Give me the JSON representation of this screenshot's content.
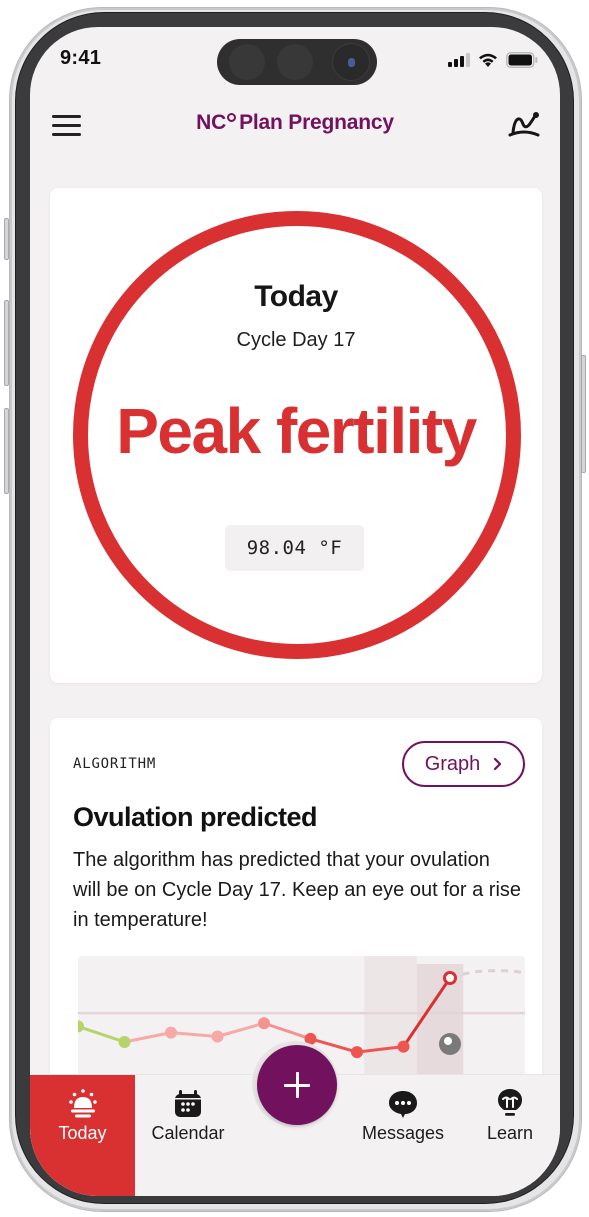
{
  "status_bar": {
    "time": "9:41",
    "icons": [
      "cellular-signal-icon",
      "wifi-icon",
      "battery-icon"
    ]
  },
  "header": {
    "brand_prefix": "NC",
    "title": "Plan Pregnancy",
    "left_icon": "hamburger-menu-icon",
    "right_icon": "graph-chart-icon",
    "brand_color": "#72115d"
  },
  "today_card": {
    "title": "Today",
    "cycle_day": "Cycle Day 17",
    "fertility_status": "Peak fertility",
    "temperature": "98.04 °F",
    "status_color": "#d93032"
  },
  "algorithm_card": {
    "label": "ALGORITHM",
    "graph_button": "Graph",
    "graph_button_icon": "chevron-right-icon",
    "title": "Ovulation predicted",
    "body": "The algorithm has predicted that your ovulation will be on Cycle Day 17. Keep an eye out for a rise in temperature!"
  },
  "chart_data": {
    "type": "line",
    "title": "",
    "xlabel": "",
    "ylabel": "",
    "grid": false,
    "series": [
      {
        "name": "temperature",
        "points": [
          {
            "day": 1,
            "value": 0.38,
            "phase": "infertile"
          },
          {
            "day": 2,
            "value": 0.18,
            "phase": "infertile"
          },
          {
            "day": 3,
            "value": 0.3,
            "phase": "fertile-low"
          },
          {
            "day": 4,
            "value": 0.25,
            "phase": "fertile-low"
          },
          {
            "day": 5,
            "value": 0.42,
            "phase": "fertile-mid"
          },
          {
            "day": 6,
            "value": 0.22,
            "phase": "fertile-high"
          },
          {
            "day": 7,
            "value": 0.05,
            "phase": "fertile-high"
          },
          {
            "day": 8,
            "value": 0.12,
            "phase": "fertile-high"
          },
          {
            "day": 9,
            "value": 1.0,
            "phase": "today"
          }
        ]
      },
      {
        "name": "prediction",
        "points": [
          {
            "day": 9,
            "value": 1.0
          },
          {
            "day": 10,
            "value": 1.1
          },
          {
            "day": 11,
            "value": 1.0
          }
        ]
      }
    ],
    "reference_line": 0.55,
    "ovulation_marker_day": 9,
    "highlight_days": [
      8,
      9
    ],
    "colors": {
      "infertile": "#b7d36b",
      "fertile-low": "#f7a9a7",
      "fertile-mid": "#f49391",
      "fertile-high": "#ee5450",
      "today": "#d93032",
      "prediction": "#ddcfd2",
      "ovulation_marker": "#7a7a7a"
    }
  },
  "tab_bar": {
    "tabs": [
      {
        "label": "Today",
        "icon": "sunrise-icon",
        "active": true
      },
      {
        "label": "Calendar",
        "icon": "calendar-icon",
        "active": false
      },
      {
        "label": "Messages",
        "icon": "chat-bubble-icon",
        "active": false
      },
      {
        "label": "Learn",
        "icon": "lightbulb-icon",
        "active": false
      }
    ],
    "fab_icon": "plus-icon",
    "active_color": "#d93032"
  }
}
